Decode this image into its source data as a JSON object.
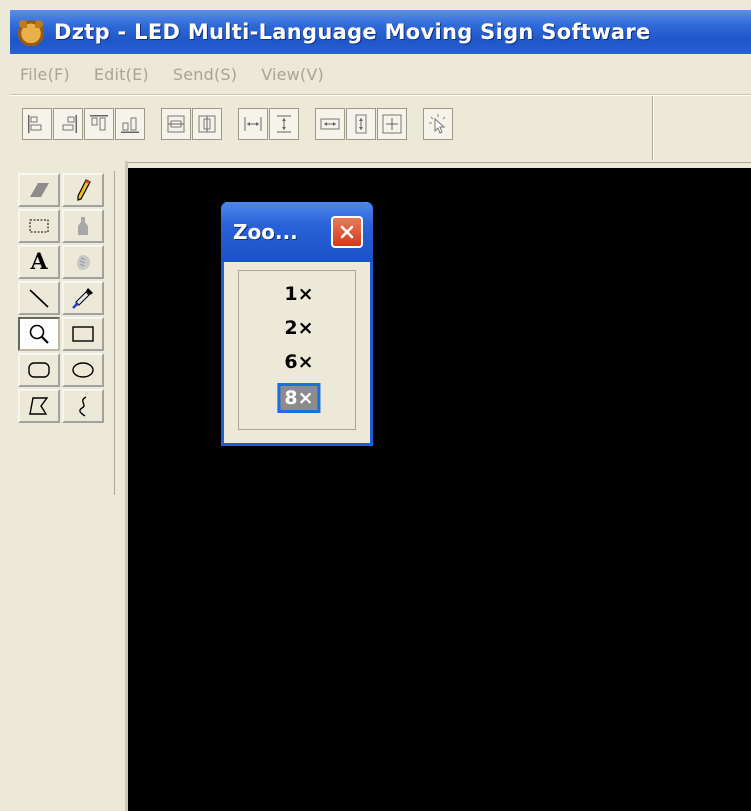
{
  "window": {
    "title": "Dztp - LED Multi-Language Moving Sign Software",
    "icon": "tiger-app-icon"
  },
  "menu": [
    "File(F)",
    "Edit(E)",
    "Send(S)",
    "View(V)"
  ],
  "toolbar": {
    "buttons": [
      "align-left-icon",
      "align-right-icon",
      "align-top-icon",
      "align-bottom-icon",
      "center-vertical-icon",
      "center-horizontal-icon",
      "space-horizontal-icon",
      "space-vertical-icon",
      "same-width-icon",
      "same-height-icon",
      "same-size-icon",
      "select-pointer-icon"
    ]
  },
  "tools": [
    "eraser-icon",
    "pencil-icon",
    "rect-select-icon",
    "bucket-icon",
    "text-icon",
    "hand-icon",
    "line-icon",
    "eyedropper-icon",
    "zoom-icon",
    "rectangle-icon",
    "rounded-rectangle-icon",
    "ellipse-icon",
    "polygon-icon",
    "curve-icon"
  ],
  "tool_labels": {
    "text": "A"
  },
  "active_tool": "zoom-icon",
  "zoom_window": {
    "title": "Zoo...",
    "options": [
      "1×",
      "2×",
      "6×",
      "8×"
    ],
    "selected": "8×"
  },
  "colors": {
    "titlebar": "#2f6ad8",
    "canvas": "#000000",
    "selection": "#1d6fe0",
    "close": "#d43a1a"
  }
}
